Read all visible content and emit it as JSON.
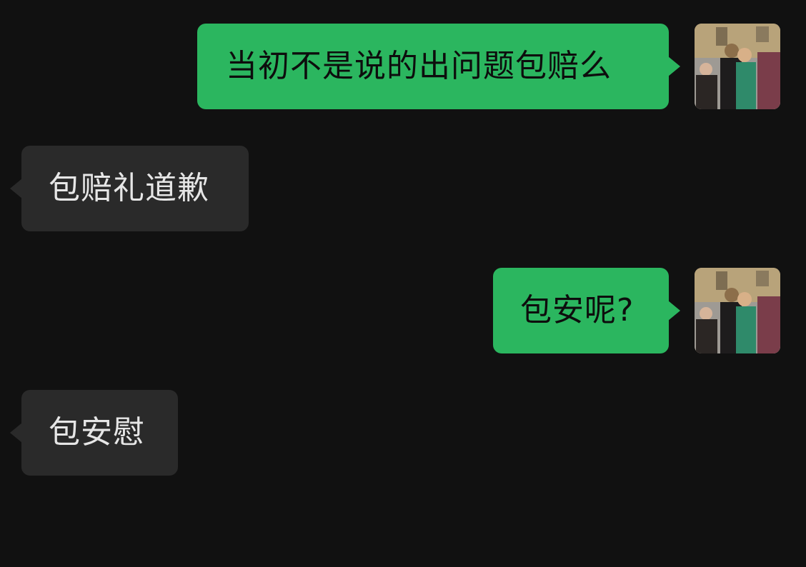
{
  "messages": [
    {
      "direction": "outgoing",
      "text": "当初不是说的出问题包赔么"
    },
    {
      "direction": "incoming",
      "text": "包赔礼道歉"
    },
    {
      "direction": "outgoing",
      "text": "包安呢?"
    },
    {
      "direction": "incoming",
      "text": "包安慰"
    }
  ],
  "colors": {
    "background": "#111111",
    "outgoing_bubble": "#2bb65f",
    "incoming_bubble": "#2a2a2a",
    "outgoing_text": "#0d0d0d",
    "incoming_text": "#e6e6e6"
  },
  "avatar": {
    "icon": "user-photo-avatar"
  }
}
